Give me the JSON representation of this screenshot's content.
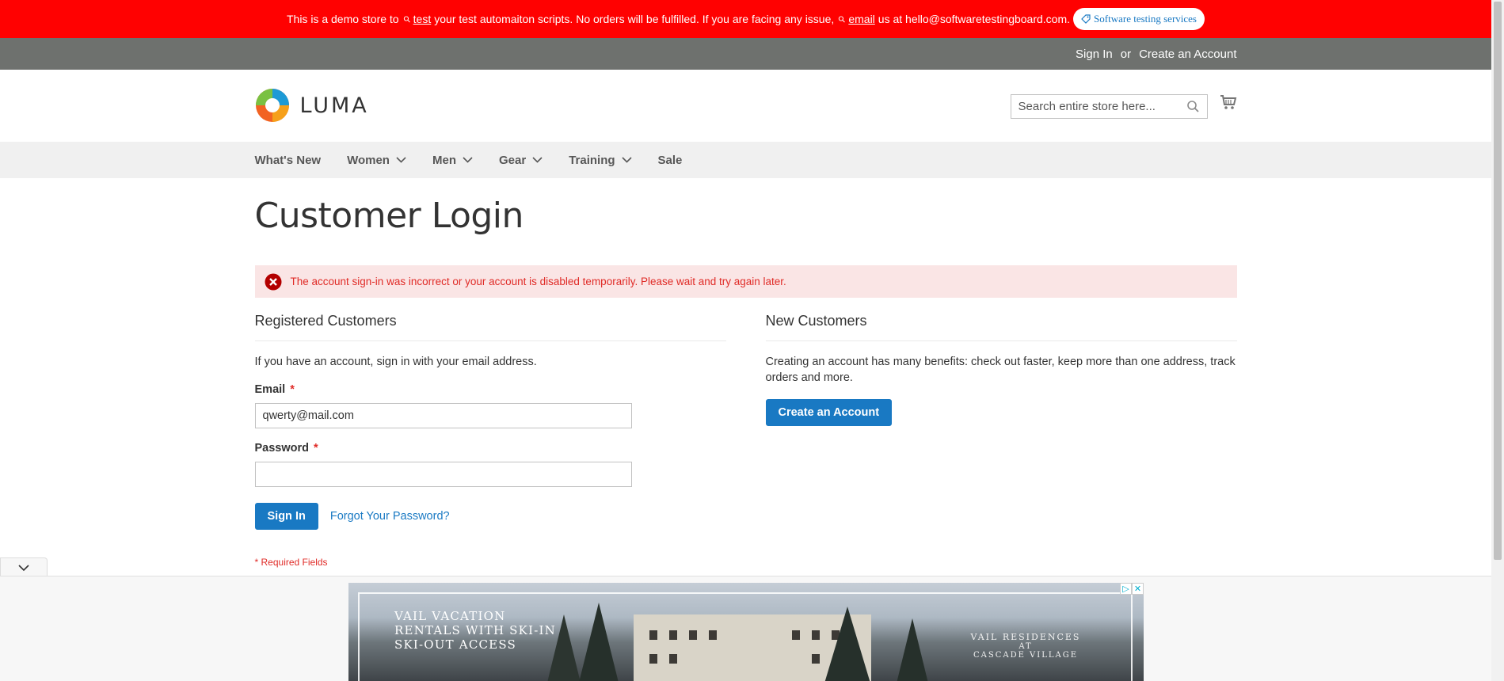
{
  "demo_bar": {
    "text_1": "This is a demo store to",
    "link_test": "test",
    "text_2": "your test automaiton scripts. No orders will be fulfilled. If you are facing any issue,",
    "link_email": "email",
    "text_3": "us at hello@softwaretestingboard.com.",
    "pill_label": "Software testing services"
  },
  "panel": {
    "sign_in": "Sign In",
    "or": "or",
    "create_account": "Create an Account"
  },
  "header": {
    "logo_text": "LUMA",
    "search_placeholder": "Search entire store here..."
  },
  "nav": {
    "items": [
      {
        "label": "What's New",
        "has_dropdown": false
      },
      {
        "label": "Women",
        "has_dropdown": true
      },
      {
        "label": "Men",
        "has_dropdown": true
      },
      {
        "label": "Gear",
        "has_dropdown": true
      },
      {
        "label": "Training",
        "has_dropdown": true
      },
      {
        "label": "Sale",
        "has_dropdown": false
      }
    ]
  },
  "page": {
    "title": "Customer Login",
    "error_message": "The account sign-in was incorrect or your account is disabled temporarily. Please wait and try again later."
  },
  "registered": {
    "heading": "Registered Customers",
    "intro": "If you have an account, sign in with your email address.",
    "email_label": "Email",
    "email_value": "qwerty@mail.com",
    "password_label": "Password",
    "password_value": "",
    "required_star": "*",
    "sign_in_button": "Sign In",
    "forgot_link": "Forgot Your Password?",
    "required_note": "* Required Fields"
  },
  "new_customers": {
    "heading": "New Customers",
    "intro": "Creating an account has many benefits: check out faster, keep more than one address, track orders and more.",
    "create_button": "Create an Account"
  },
  "ad": {
    "line_1": "VAIL VACATION",
    "line_2": "RENTALS WITH SKI-IN",
    "line_3": "SKI-OUT ACCESS",
    "brand_1": "VAIL RESIDENCES",
    "brand_2": "AT",
    "brand_3": "CASCADE VILLAGE"
  },
  "colors": {
    "demo_bar": "#ff0101",
    "panel": "#6e716e",
    "primary": "#1979c3",
    "error_text": "#e02b27",
    "error_bg": "#fae5e5"
  }
}
